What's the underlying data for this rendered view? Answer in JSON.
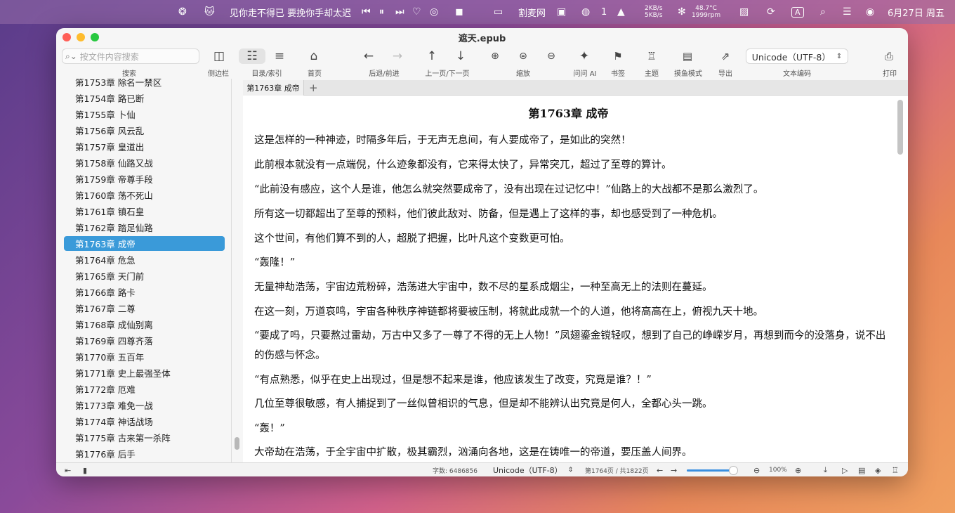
{
  "menubar": {
    "now_playing": "见你走不得已 要挽你手却太迟",
    "app_name": "割麦网",
    "wechat_badge": "1",
    "net_up": "2KB/s",
    "net_down": "5KB/s",
    "temp": "48.7°C",
    "fan": "1999rpm",
    "input_method": "A",
    "date": "6月27日 周五"
  },
  "window": {
    "title": "遮天.epub"
  },
  "toolbar": {
    "search_placeholder": "按文件内容搜索",
    "search_label": "搜索",
    "sidebar_label": "侧边栏",
    "toc_label": "目录/索引",
    "home_label": "首页",
    "nav_label": "后退/前进",
    "page_label": "上一页/下一页",
    "zoom_label": "缩放",
    "ai_label": "问问 AI",
    "bookmark_label": "书签",
    "theme_label": "主题",
    "fish_label": "摸鱼模式",
    "export_label": "导出",
    "encoding_value": "Unicode（UTF-8）",
    "encoding_label": "文本编码",
    "print_label": "打印"
  },
  "sidebar": {
    "chapters": [
      "第1753章 除名一禁区",
      "第1754章 路已断",
      "第1755章 卜仙",
      "第1756章 风云乱",
      "第1757章 皇道出",
      "第1758章 仙路又战",
      "第1759章 帝尊手段",
      "第1760章 荡不死山",
      "第1761章 镇石皇",
      "第1762章 踏足仙路",
      "第1763章 成帝",
      "第1764章 危急",
      "第1765章 天门前",
      "第1766章 路卡",
      "第1767章 二尊",
      "第1768章 成仙别离",
      "第1769章 四尊齐落",
      "第1770章 五百年",
      "第1771章 史上最强圣体",
      "第1772章 厄难",
      "第1773章 难免一战",
      "第1774章 神话战场",
      "第1775章 古来第一杀阵",
      "第1776章 后手"
    ],
    "selected_index": 10
  },
  "tabs": {
    "current": "第1763章 成帝",
    "add": "+"
  },
  "content": {
    "title": "第1763章 成帝",
    "paragraphs": [
      "这是怎样的一种神迹，时隔多年后，于无声无息间，有人要成帝了，是如此的突然！",
      "此前根本就没有一点端倪，什么迹象都没有，它来得太快了，异常突兀，超过了至尊的算计。",
      "“此前没有感应，这个人是谁，他怎么就突然要成帝了，没有出现在过记忆中！”仙路上的大战都不是那么激烈了。",
      "所有这一切都超出了至尊的预料，他们彼此敌对、防备，但是遇上了这样的事，却也感受到了一种危机。",
      "这个世间，有他们算不到的人，超脱了把握，比叶凡这个变数更可怕。",
      "“轰隆！”",
      "无量神劫浩荡，宇宙边荒粉碎，浩荡进大宇宙中，数不尽的星系成烟尘，一种至高无上的法则在蔓延。",
      "在这一刻，万道哀鸣，宇宙各种秩序神链都将要被压制，将就此成就一个的人道，他将高高在上，俯视九天十地。",
      "“要成了吗，只要熬过雷劫，万古中又多了一尊了不得的无上人物！”凤翅鎏金镋轻叹，想到了自己的峥嵘岁月，再想到而今的没落身，说不出的伤感与怀念。",
      "“有点熟悉，似乎在史上出现过，但是想不起来是谁，他应该发生了改变，究竟是谁？！”",
      "几位至尊很敏感，有人捕捉到了一丝似曾相识的气息，但是却不能辨认出究竟是何人，全都心头一跳。",
      "“轰！”",
      "大帝劫在浩荡，于全宇宙中扩散，极其霸烈，汹涌向各地，这是在铸唯一的帝道，要压盖人间界。"
    ]
  },
  "statusbar": {
    "word_count": "字数: 6486856",
    "encoding": "Unicode（UTF-8）",
    "page_info": "第1764页 / 共1822页",
    "zoom_percent": "100%",
    "slider_value": 0.95
  },
  "colors": {
    "selection": "#3a9ad9",
    "slider": "#3a8fe0"
  }
}
